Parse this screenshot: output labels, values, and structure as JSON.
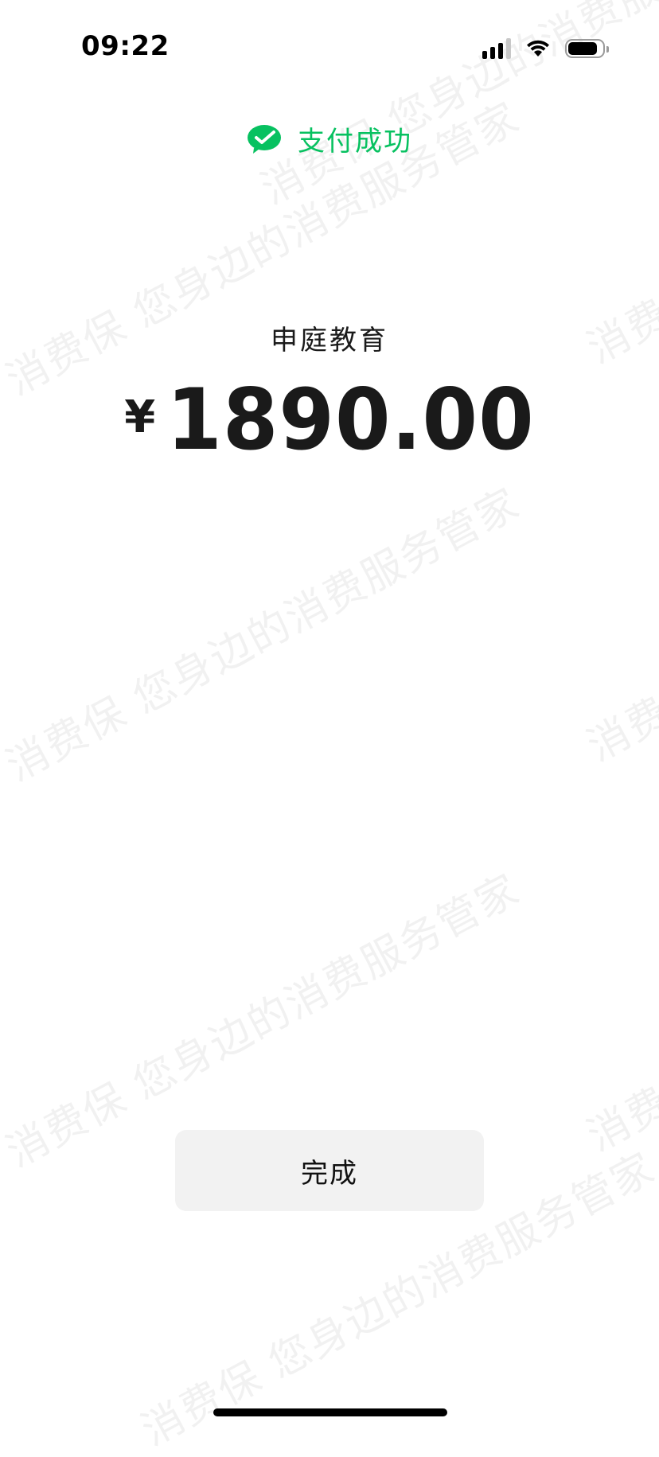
{
  "status_bar": {
    "time": "09:22"
  },
  "result": {
    "title": "支付成功",
    "icon": "wechat-pay-success-icon",
    "accent_color": "#07c160"
  },
  "payment": {
    "merchant": "申庭教育",
    "currency_symbol": "¥",
    "amount": "1890.00"
  },
  "actions": {
    "done_label": "完成"
  },
  "watermark": {
    "text": "消费保 您身边的消费服务管家"
  }
}
